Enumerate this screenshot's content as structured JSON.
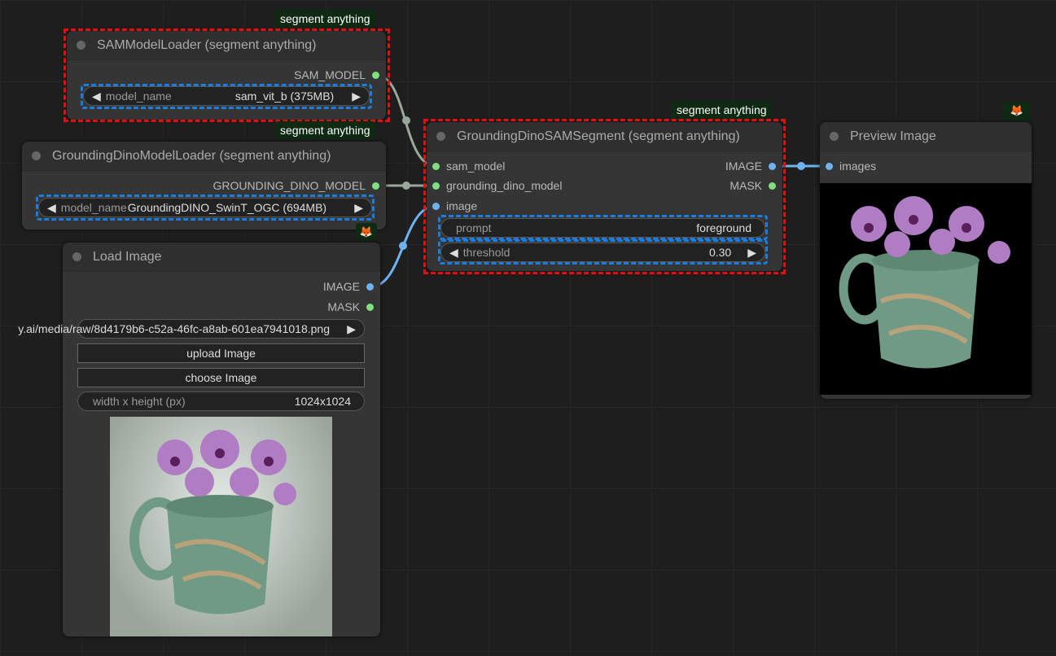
{
  "nodes": {
    "sam_loader": {
      "title": "SAMModelLoader (segment anything)",
      "badge": "segment anything",
      "output": "SAM_MODEL",
      "widget_label": "model_name",
      "widget_value": "sam_vit_b (375MB)"
    },
    "dino_loader": {
      "title": "GroundingDinoModelLoader (segment anything)",
      "badge": "segment anything",
      "output": "GROUNDING_DINO_MODEL",
      "widget_label": "model_name",
      "widget_value": "GroundingDINO_SwinT_OGC (694MB)"
    },
    "load_image": {
      "title": "Load Image",
      "outputs": [
        "IMAGE",
        "MASK"
      ],
      "image_path": "y.ai/media/raw/8d4179b6-c52a-46fc-a8ab-601ea7941018.png",
      "upload_label": "upload Image",
      "choose_label": "choose Image",
      "size_label": "width x height (px)",
      "size_value": "1024x1024"
    },
    "segment": {
      "title": "GroundingDinoSAMSegment (segment anything)",
      "badge": "segment anything",
      "inputs": [
        "sam_model",
        "grounding_dino_model",
        "image"
      ],
      "outputs": [
        "IMAGE",
        "MASK"
      ],
      "prompt_label": "prompt",
      "prompt_value": "foreground",
      "threshold_label": "threshold",
      "threshold_value": "0.30"
    },
    "preview": {
      "title": "Preview Image",
      "input": "images"
    }
  },
  "icons": {
    "fox": "fox-icon",
    "left": "◀",
    "right": "▶"
  },
  "colors": {
    "selection": "#e41010",
    "widget_highlight": "#1b7de0",
    "model_slot": "#7ee07e",
    "image_slot": "#6fb2f0"
  }
}
